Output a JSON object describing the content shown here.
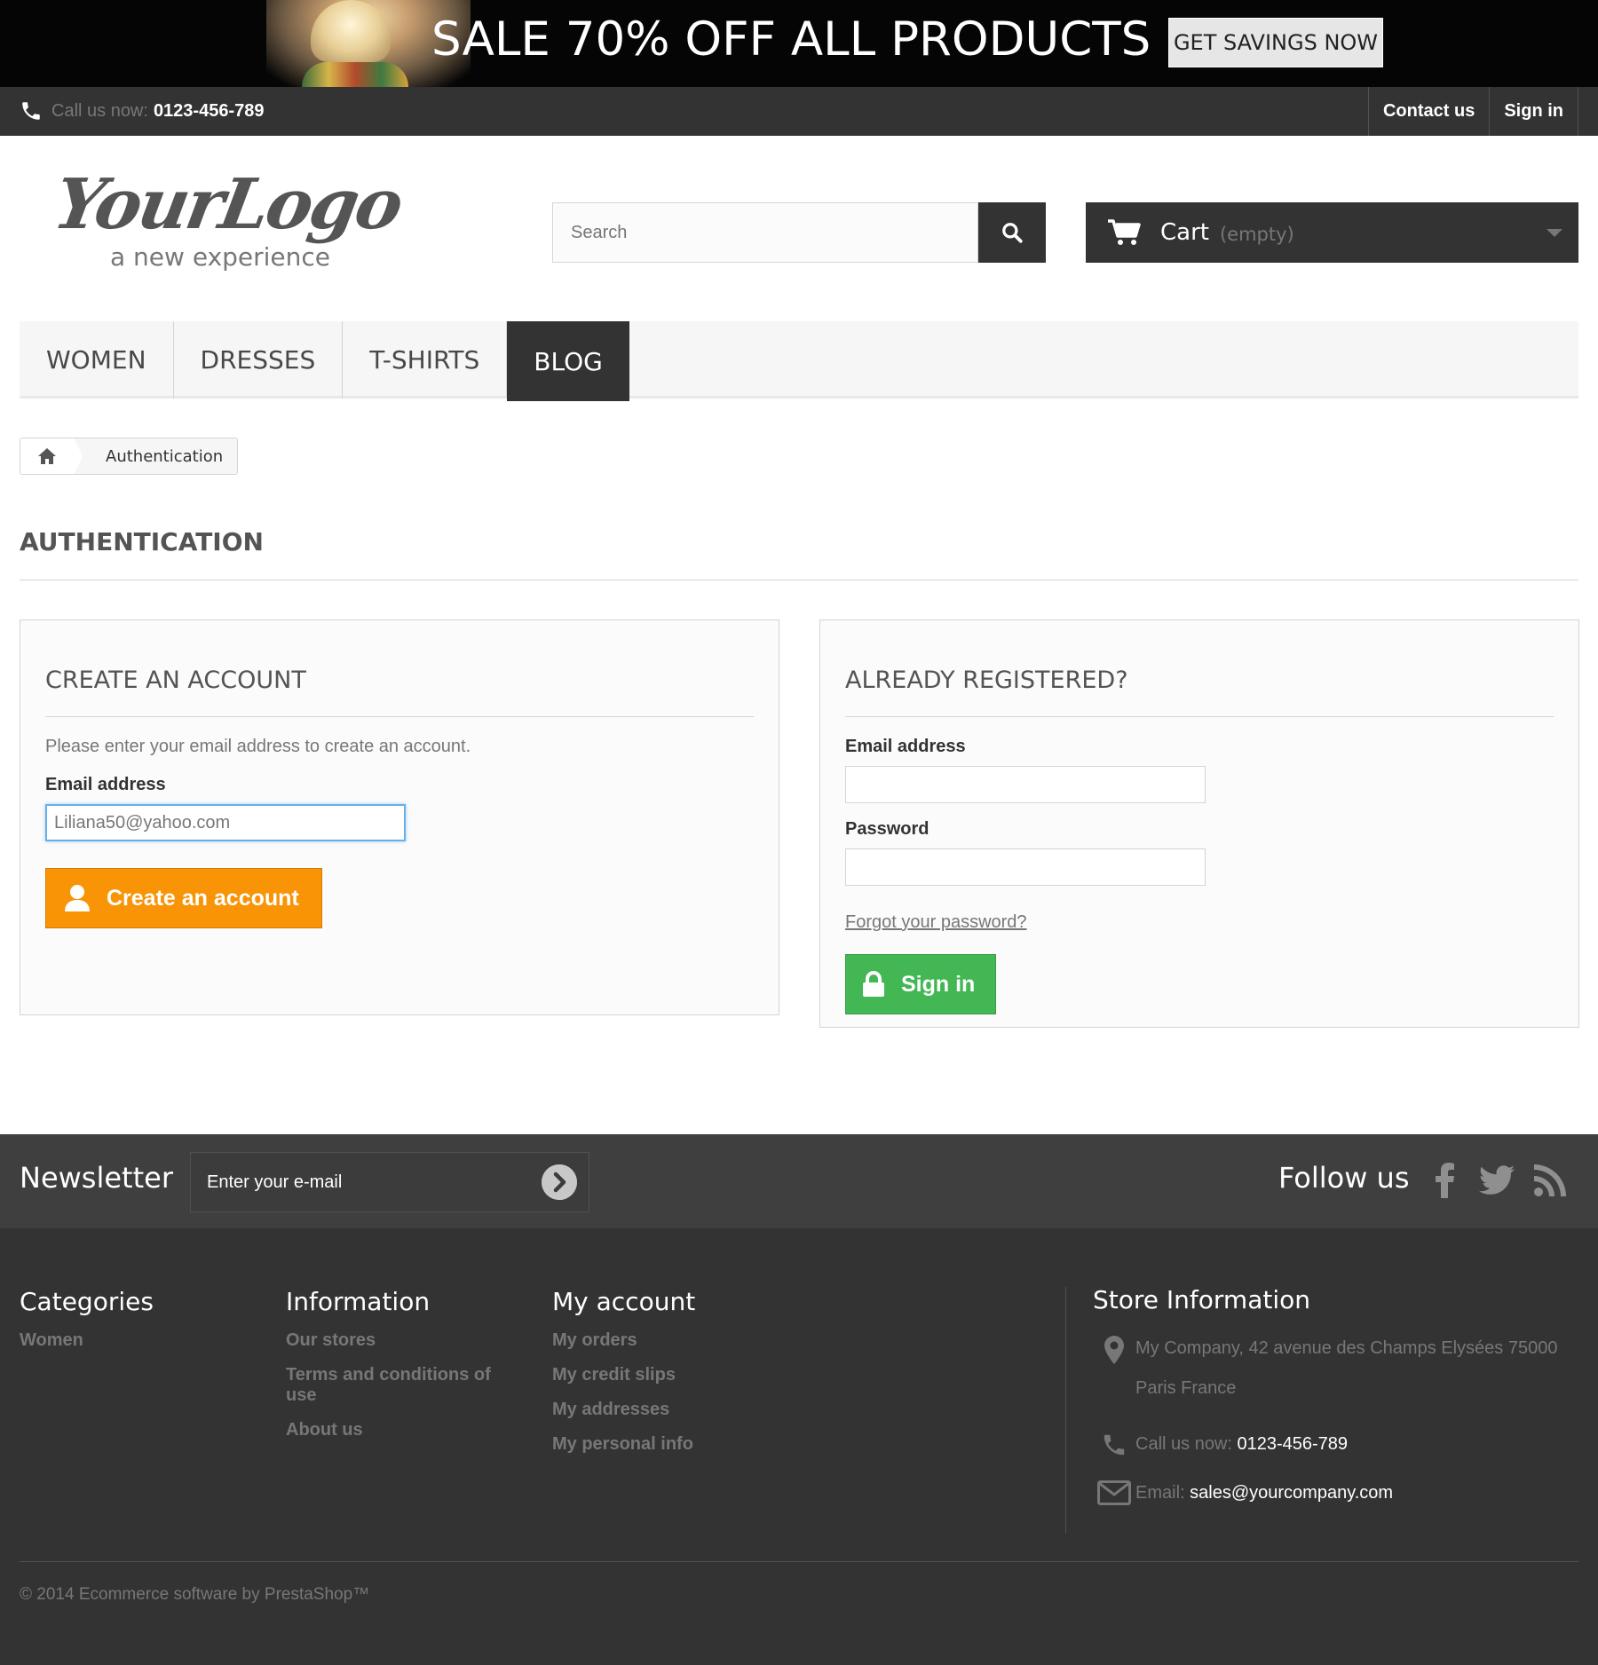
{
  "banner": {
    "title": "SALE 70% OFF ALL PRODUCTS",
    "button": "GET SAVINGS NOW"
  },
  "topbar": {
    "call_label": "Call us now:",
    "phone": "0123-456-789",
    "links": [
      "Contact us",
      "Sign in"
    ]
  },
  "header": {
    "logo_text": "YourLogo",
    "logo_tagline": "a new experience",
    "search_placeholder": "Search",
    "cart_label": "Cart",
    "cart_status": "(empty)"
  },
  "nav": {
    "items": [
      "WOMEN",
      "DRESSES",
      "T-SHIRTS",
      "BLOG"
    ],
    "active": "BLOG"
  },
  "breadcrumb": {
    "current": "Authentication"
  },
  "page": {
    "heading": "AUTHENTICATION"
  },
  "create_account": {
    "title": "CREATE AN ACCOUNT",
    "description": "Please enter your email address to create an account.",
    "email_label": "Email address",
    "email_value": "Liliana50@yahoo.com",
    "button": "Create an account"
  },
  "login": {
    "title": "ALREADY REGISTERED?",
    "email_label": "Email address",
    "email_value": "",
    "password_label": "Password",
    "password_value": "",
    "forgot": "Forgot your password?",
    "button": "Sign in"
  },
  "newsletter": {
    "title": "Newsletter",
    "placeholder": "Enter your e-mail",
    "follow": "Follow us"
  },
  "footer": {
    "categories": {
      "title": "Categories",
      "links": [
        "Women"
      ]
    },
    "information": {
      "title": "Information",
      "links": [
        "Our stores",
        "Terms and conditions of use",
        "About us"
      ]
    },
    "account": {
      "title": "My account",
      "links": [
        "My orders",
        "My credit slips",
        "My addresses",
        "My personal info"
      ]
    },
    "store": {
      "title": "Store Information",
      "address": "My Company, 42 avenue des Champs Elysées 75000 Paris France",
      "call_label": "Call us now:",
      "phone": "0123-456-789",
      "email_label": "Email:",
      "email": "sales@yourcompany.com"
    },
    "copyright": "© 2014 Ecommerce software by PrestaShop™"
  },
  "colors": {
    "dark": "#333333",
    "orange": "#f89406",
    "green": "#43b754",
    "focus": "#66afe9"
  }
}
